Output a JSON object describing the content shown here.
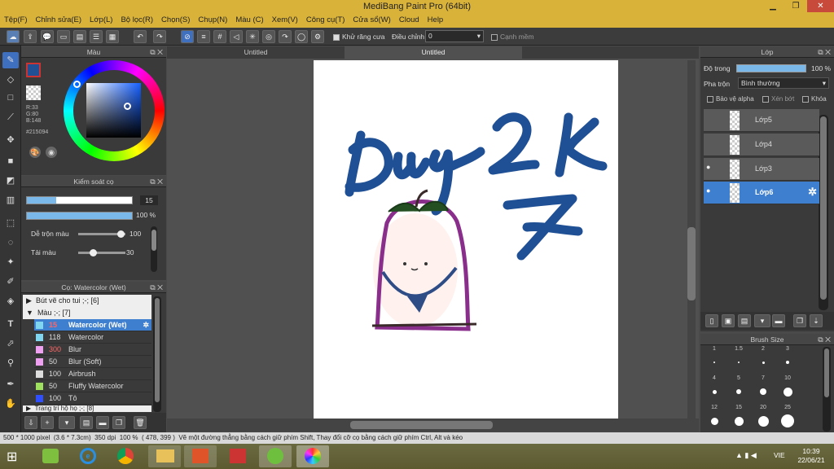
{
  "window": {
    "title": "MediBang Paint Pro (64bit)"
  },
  "menu": [
    "Tệp(F)",
    "Chỉnh sửa(E)",
    "Lớp(L)",
    "Bộ lọc(R)",
    "Chọn(S)",
    "Chụp(N)",
    "Màu (C)",
    "Xem(V)",
    "Công cụ(T)",
    "Cửa sổ(W)",
    "Cloud",
    "Help"
  ],
  "toolbar": {
    "antialias_label": "Khử răng cưa",
    "adjust_label": "Điều chỉnh",
    "adjust_value": "0",
    "edge_label": "Cạnh mềm"
  },
  "tabs": [
    "Untitled",
    "Untitled"
  ],
  "color_panel": {
    "title": "Màu",
    "r": "R:33",
    "g": "G:80",
    "b": "B:148",
    "hex": "#215094",
    "current": "#215094"
  },
  "brush_control": {
    "title": "Kiểm soát cọ",
    "size": "15",
    "opacity": "100 %",
    "blend_label": "Dễ trộn màu",
    "blend_value": "100",
    "ratio_label": "Tải màu",
    "ratio_value": "30"
  },
  "brush_panel": {
    "title": "Cọ: Watercolor (Wet)",
    "groups": [
      {
        "label": "Bút vẽ cho tui ;-; [6]"
      },
      {
        "label": "Màu ;-; [7]"
      }
    ],
    "items": [
      {
        "size": "15",
        "name": "Watercolor (Wet)",
        "color": "#7fd6ee"
      },
      {
        "size": "118",
        "name": "Watercolor",
        "color": "#7fd6ee"
      },
      {
        "size": "300",
        "name": "Blur",
        "color": "#f0a0f0"
      },
      {
        "size": "50",
        "name": "Blur (Soft)",
        "color": "#f0a0f0"
      },
      {
        "size": "100",
        "name": "Airbrush",
        "color": "#dddddd"
      },
      {
        "size": "50",
        "name": "Fluffy Watercolor",
        "color": "#a0e060"
      },
      {
        "size": "100",
        "name": "Tô",
        "color": "#3050ff"
      }
    ],
    "footer_group": "Trang trí hộ họ ;-; [8]"
  },
  "layer_panel": {
    "title": "Lớp",
    "opacity_label": "Độ trong",
    "opacity_value": "100 %",
    "blend_label": "Pha trộn",
    "blend_value": "Bình thường",
    "protect_alpha": "Bảo vệ alpha",
    "clipping": "Xén bớt",
    "lock": "Khóa",
    "layers": [
      "Lớp5",
      "Lớp4",
      "Lớp3",
      "Lớp6"
    ]
  },
  "brush_size_panel": {
    "title": "Brush Size",
    "sizes": [
      "1",
      "1.5",
      "2",
      "3",
      "4",
      "5",
      "7",
      "10",
      "12",
      "15",
      "20",
      "25"
    ]
  },
  "statusbar": {
    "dims": "500 * 1000 pixel",
    "cm": "(3.6 * 7.3cm)",
    "dpi": "350 dpi",
    "zoom": "100 %",
    "coords": "( 478, 399 )",
    "hint": "Vẽ một đường thẳng bằng cách giữ phím Shift, Thay đổi cỡ cọ bằng cách giữ phím Ctrl, Alt và kéo"
  },
  "taskbar": {
    "lang": "VIE",
    "time": "10:39",
    "date": "22/06/21"
  },
  "drawing_text": [
    "Duy",
    "2",
    "K",
    "7"
  ]
}
